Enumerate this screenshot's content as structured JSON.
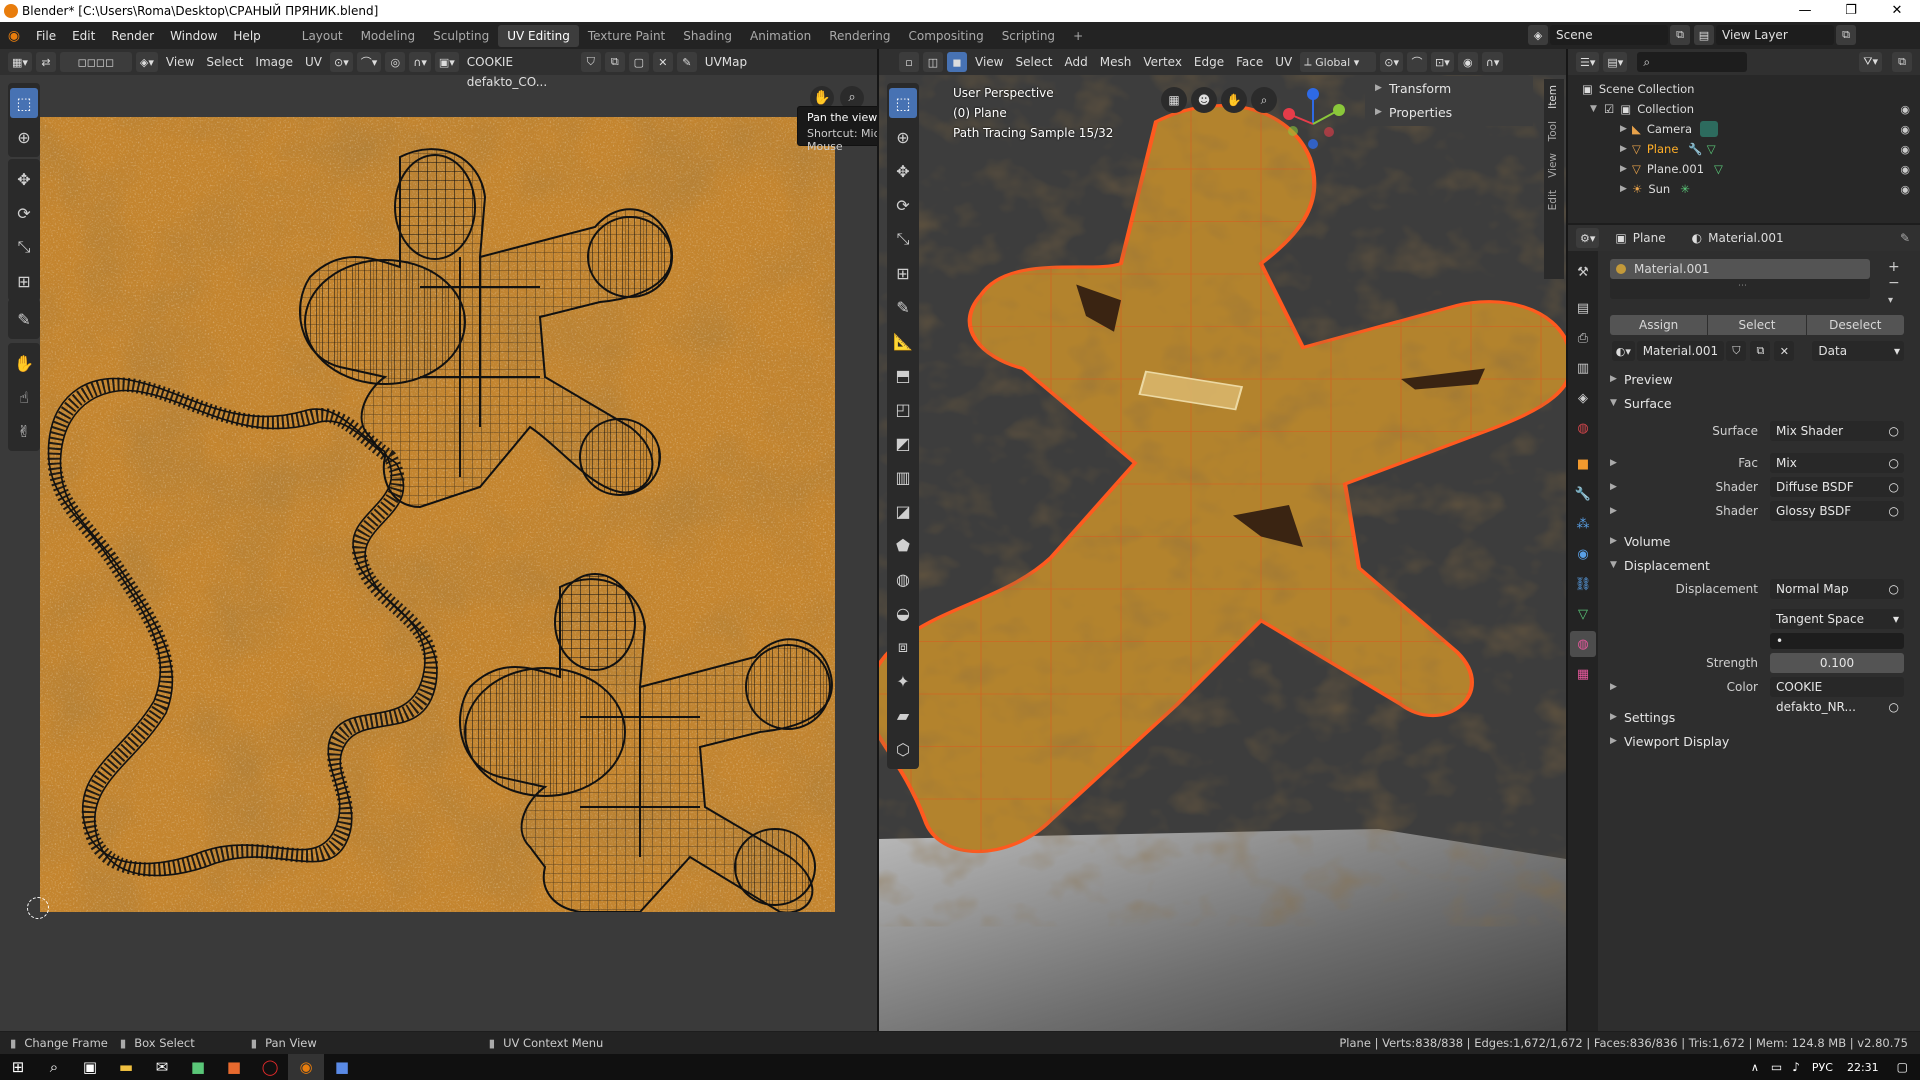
{
  "window": {
    "title": "Blender* [C:\\Users\\Roma\\Desktop\\СРАНЫЙ ПРЯНИК.blend]",
    "minimize": "—",
    "maximize": "❐",
    "close": "✕"
  },
  "menu": [
    "File",
    "Edit",
    "Render",
    "Window",
    "Help"
  ],
  "workspaces": [
    "Layout",
    "Modeling",
    "Sculpting",
    "UV Editing",
    "Texture Paint",
    "Shading",
    "Animation",
    "Rendering",
    "Compositing",
    "Scripting"
  ],
  "scene": {
    "name": "Scene",
    "view_layer": "View Layer"
  },
  "uv_editor": {
    "header": {
      "view": "View",
      "select": "Select",
      "image": "Image",
      "uv": "UV",
      "image_name": "COOKIE defakto_CO...",
      "uvmap": "UVMap"
    },
    "tooltip": {
      "title": "Pan the view",
      "shortcut": "Shortcut: Middle Mouse"
    },
    "colors": {
      "texture_base": "#c4852f",
      "wire": "#111111"
    }
  },
  "viewport": {
    "header": {
      "view": "View",
      "select": "Select",
      "add": "Add",
      "mesh": "Mesh",
      "vertex": "Vertex",
      "edge": "Edge",
      "face": "Face",
      "uv": "UV",
      "orientation": "Global"
    },
    "overlay": {
      "perspective": "User Perspective",
      "object": "(0) Plane",
      "sample": "Path Tracing Sample 15/32"
    },
    "sidebar_panels": [
      "Transform",
      "Properties"
    ],
    "sidebar_tabs": [
      "Item",
      "Tool",
      "View",
      "Edit"
    ],
    "colors": {
      "mesh": "#b3832d",
      "edge": "#ff5a1f",
      "background": "#3d3d3d"
    }
  },
  "outliner": {
    "root": "Scene Collection",
    "collection": "Collection",
    "items": [
      {
        "name": "Camera",
        "color": "#d8d8d8"
      },
      {
        "name": "Plane",
        "color": "#ffaf29"
      },
      {
        "name": "Plane.001",
        "color": "#d8d8d8"
      },
      {
        "name": "Sun",
        "color": "#d8d8d8"
      }
    ]
  },
  "properties": {
    "object": "Plane",
    "material": "Material.001",
    "slot": "Material.001",
    "assign": "Assign",
    "select": "Select",
    "deselect": "Deselect",
    "material_field": "Material.001",
    "link": "Data",
    "sections": {
      "preview": "Preview",
      "surface": "Surface",
      "volume": "Volume",
      "displacement": "Displacement",
      "settings": "Settings",
      "viewport_display": "Viewport Display"
    },
    "surface_rows": [
      {
        "label": "Surface",
        "value": "Mix Shader"
      },
      {
        "label": "Fac",
        "value": "Mix"
      },
      {
        "label": "Shader",
        "value": "Diffuse BSDF"
      },
      {
        "label": "Shader",
        "value": "Glossy BSDF"
      }
    ],
    "displacement_rows": {
      "displacement_label": "Displacement",
      "displacement_value": "Normal Map",
      "space": "Tangent Space",
      "uv_value": "•",
      "strength_label": "Strength",
      "strength_value": "0.100",
      "color_label": "Color",
      "color_value": "COOKIE defakto_NR..."
    }
  },
  "status": {
    "change_frame": "Change Frame",
    "box_select": "Box Select",
    "pan_view": "Pan View",
    "uv_context": "UV Context Menu",
    "stats": "Plane | Verts:838/838 | Edges:1,672/1,672 | Faces:836/836 | Tris:1,672 | Mem: 124.8 MB | v2.80.75"
  },
  "taskbar": {
    "lang": "РУС",
    "time": "22:31"
  }
}
